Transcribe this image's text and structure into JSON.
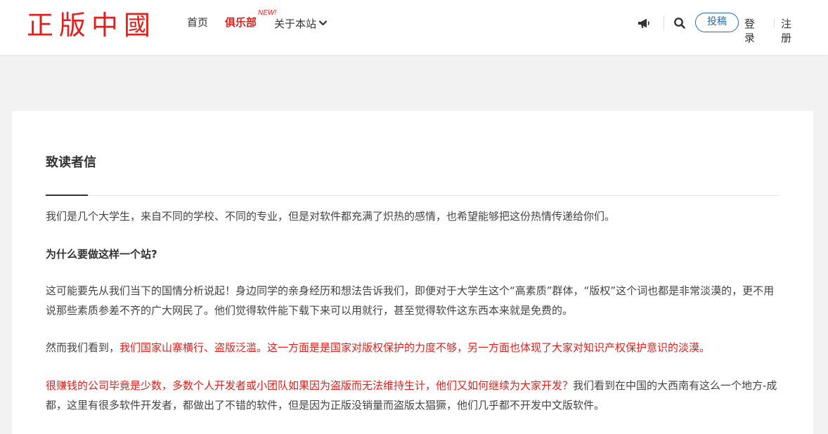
{
  "header": {
    "logo_text": "正版中國",
    "nav": {
      "home": "首页",
      "club": "俱乐部",
      "new_badge": "NEW!",
      "about": "关于本站"
    },
    "submit_label": "投稿",
    "login_label": "登录",
    "register_label": "注册"
  },
  "article": {
    "title": "致读者信",
    "p1": "我们是几个大学生，来自不同的学校、不同的专业，但是对软件都充满了炽热的感情，也希望能够把这份热情传递给你们。",
    "heading": "为什么要做这样一个站?",
    "p2": "这可能要先从我们当下的国情分析说起！身边同学的亲身经历和想法告诉我们，即便对于大学生这个“高素质”群体，“版权”这个词也都是非常淡漠的，更不用说那些素质参差不齐的广大网民了。他们觉得软件能下载下来可以用就行，甚至觉得软件这东西本来就是免费的。",
    "p3_normal": "然而我们看到，",
    "p3_red": "我们国家山寨横行、盗版泛滥。这一方面是是国家对版权保护的力度不够，另一方面也体现了大家对知识产权保护意识的淡漠。",
    "p4_red": "很赚钱的公司毕竟是少数，多数个人开发者或小团队如果因为盗版而无法维持生计，他们又如何继续为大家开发？",
    "p4_normal": "我们看到在中国的大西南有这么一个地方-成都，这里有很多软件开发者，都做出了不错的软件，但是因为正版没销量而盗版太猖獗，他们几乎都不开发中文版软件。"
  },
  "colors": {
    "brand_red": "#e0201c",
    "accent_blue": "#2a6cb0",
    "page_bg": "#f2f2f2"
  },
  "icons": [
    "megaphone-icon",
    "search-icon",
    "chevron-down-icon"
  ]
}
